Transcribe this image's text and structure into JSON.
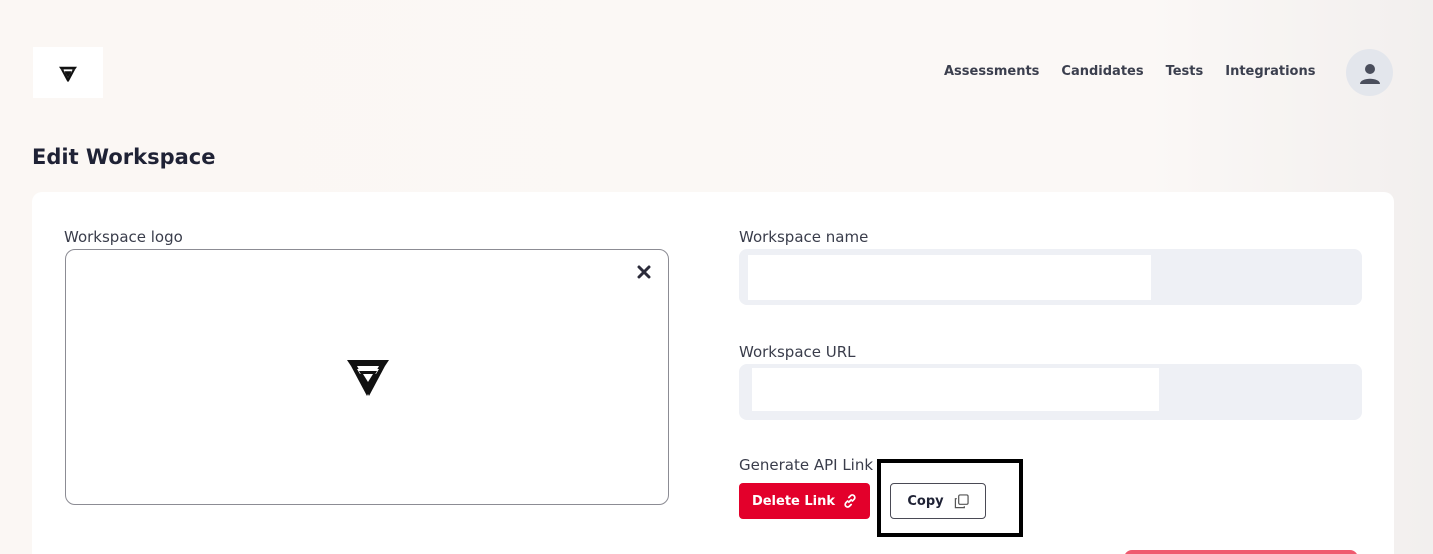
{
  "header": {
    "nav": [
      "Assessments",
      "Candidates",
      "Tests",
      "Integrations"
    ]
  },
  "page": {
    "title": "Edit Workspace"
  },
  "form": {
    "logo_label": "Workspace logo",
    "name_label": "Workspace name",
    "name_value": "",
    "url_label": "Workspace URL",
    "url_value": "",
    "api_label": "Generate API Link",
    "delete_link_label": "Delete Link",
    "copy_label": "Copy"
  },
  "colors": {
    "accent": "#e3002b",
    "background": "#fbf7f4",
    "field_bg": "#eef0f5"
  },
  "icons": {
    "brand": "triangle-knot-logo",
    "avatar": "user-icon",
    "remove": "close-icon",
    "link": "link-icon",
    "copy": "copy-icon"
  }
}
